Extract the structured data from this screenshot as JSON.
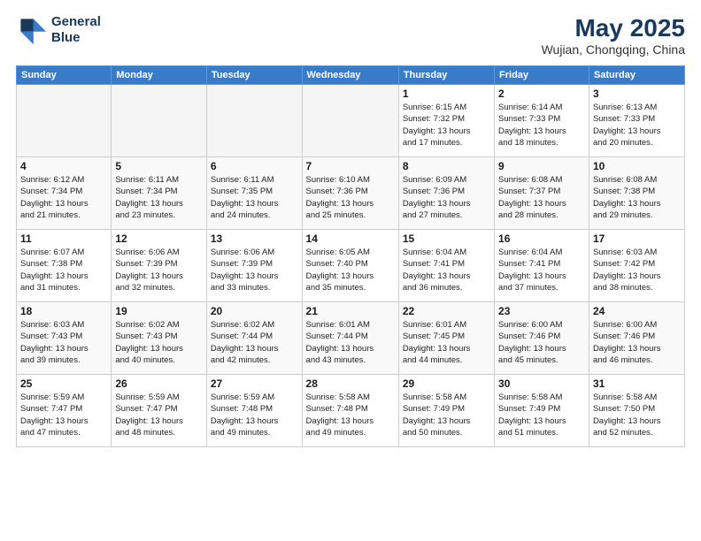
{
  "header": {
    "logo_line1": "General",
    "logo_line2": "Blue",
    "month": "May 2025",
    "location": "Wujian, Chongqing, China"
  },
  "weekdays": [
    "Sunday",
    "Monday",
    "Tuesday",
    "Wednesday",
    "Thursday",
    "Friday",
    "Saturday"
  ],
  "weeks": [
    [
      {
        "day": "",
        "detail": ""
      },
      {
        "day": "",
        "detail": ""
      },
      {
        "day": "",
        "detail": ""
      },
      {
        "day": "",
        "detail": ""
      },
      {
        "day": "1",
        "detail": "Sunrise: 6:15 AM\nSunset: 7:32 PM\nDaylight: 13 hours\nand 17 minutes."
      },
      {
        "day": "2",
        "detail": "Sunrise: 6:14 AM\nSunset: 7:33 PM\nDaylight: 13 hours\nand 18 minutes."
      },
      {
        "day": "3",
        "detail": "Sunrise: 6:13 AM\nSunset: 7:33 PM\nDaylight: 13 hours\nand 20 minutes."
      }
    ],
    [
      {
        "day": "4",
        "detail": "Sunrise: 6:12 AM\nSunset: 7:34 PM\nDaylight: 13 hours\nand 21 minutes."
      },
      {
        "day": "5",
        "detail": "Sunrise: 6:11 AM\nSunset: 7:34 PM\nDaylight: 13 hours\nand 23 minutes."
      },
      {
        "day": "6",
        "detail": "Sunrise: 6:11 AM\nSunset: 7:35 PM\nDaylight: 13 hours\nand 24 minutes."
      },
      {
        "day": "7",
        "detail": "Sunrise: 6:10 AM\nSunset: 7:36 PM\nDaylight: 13 hours\nand 25 minutes."
      },
      {
        "day": "8",
        "detail": "Sunrise: 6:09 AM\nSunset: 7:36 PM\nDaylight: 13 hours\nand 27 minutes."
      },
      {
        "day": "9",
        "detail": "Sunrise: 6:08 AM\nSunset: 7:37 PM\nDaylight: 13 hours\nand 28 minutes."
      },
      {
        "day": "10",
        "detail": "Sunrise: 6:08 AM\nSunset: 7:38 PM\nDaylight: 13 hours\nand 29 minutes."
      }
    ],
    [
      {
        "day": "11",
        "detail": "Sunrise: 6:07 AM\nSunset: 7:38 PM\nDaylight: 13 hours\nand 31 minutes."
      },
      {
        "day": "12",
        "detail": "Sunrise: 6:06 AM\nSunset: 7:39 PM\nDaylight: 13 hours\nand 32 minutes."
      },
      {
        "day": "13",
        "detail": "Sunrise: 6:06 AM\nSunset: 7:39 PM\nDaylight: 13 hours\nand 33 minutes."
      },
      {
        "day": "14",
        "detail": "Sunrise: 6:05 AM\nSunset: 7:40 PM\nDaylight: 13 hours\nand 35 minutes."
      },
      {
        "day": "15",
        "detail": "Sunrise: 6:04 AM\nSunset: 7:41 PM\nDaylight: 13 hours\nand 36 minutes."
      },
      {
        "day": "16",
        "detail": "Sunrise: 6:04 AM\nSunset: 7:41 PM\nDaylight: 13 hours\nand 37 minutes."
      },
      {
        "day": "17",
        "detail": "Sunrise: 6:03 AM\nSunset: 7:42 PM\nDaylight: 13 hours\nand 38 minutes."
      }
    ],
    [
      {
        "day": "18",
        "detail": "Sunrise: 6:03 AM\nSunset: 7:43 PM\nDaylight: 13 hours\nand 39 minutes."
      },
      {
        "day": "19",
        "detail": "Sunrise: 6:02 AM\nSunset: 7:43 PM\nDaylight: 13 hours\nand 40 minutes."
      },
      {
        "day": "20",
        "detail": "Sunrise: 6:02 AM\nSunset: 7:44 PM\nDaylight: 13 hours\nand 42 minutes."
      },
      {
        "day": "21",
        "detail": "Sunrise: 6:01 AM\nSunset: 7:44 PM\nDaylight: 13 hours\nand 43 minutes."
      },
      {
        "day": "22",
        "detail": "Sunrise: 6:01 AM\nSunset: 7:45 PM\nDaylight: 13 hours\nand 44 minutes."
      },
      {
        "day": "23",
        "detail": "Sunrise: 6:00 AM\nSunset: 7:46 PM\nDaylight: 13 hours\nand 45 minutes."
      },
      {
        "day": "24",
        "detail": "Sunrise: 6:00 AM\nSunset: 7:46 PM\nDaylight: 13 hours\nand 46 minutes."
      }
    ],
    [
      {
        "day": "25",
        "detail": "Sunrise: 5:59 AM\nSunset: 7:47 PM\nDaylight: 13 hours\nand 47 minutes."
      },
      {
        "day": "26",
        "detail": "Sunrise: 5:59 AM\nSunset: 7:47 PM\nDaylight: 13 hours\nand 48 minutes."
      },
      {
        "day": "27",
        "detail": "Sunrise: 5:59 AM\nSunset: 7:48 PM\nDaylight: 13 hours\nand 49 minutes."
      },
      {
        "day": "28",
        "detail": "Sunrise: 5:58 AM\nSunset: 7:48 PM\nDaylight: 13 hours\nand 49 minutes."
      },
      {
        "day": "29",
        "detail": "Sunrise: 5:58 AM\nSunset: 7:49 PM\nDaylight: 13 hours\nand 50 minutes."
      },
      {
        "day": "30",
        "detail": "Sunrise: 5:58 AM\nSunset: 7:49 PM\nDaylight: 13 hours\nand 51 minutes."
      },
      {
        "day": "31",
        "detail": "Sunrise: 5:58 AM\nSunset: 7:50 PM\nDaylight: 13 hours\nand 52 minutes."
      }
    ]
  ]
}
